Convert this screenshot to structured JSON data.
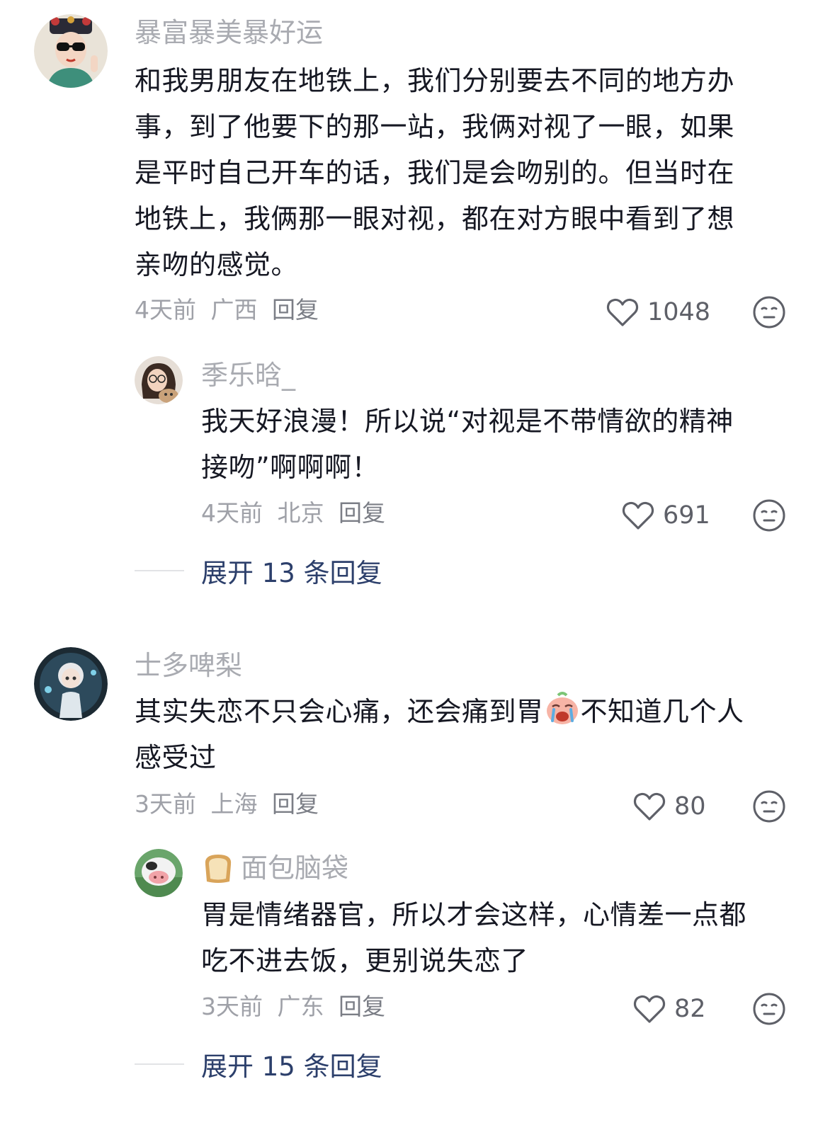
{
  "comments": [
    {
      "username": "暴富暴美暴好运",
      "text_lines": [
        "和我男朋友在地铁上，我们分别要去不同的地方办",
        "事，到了他要下的那一站，我俩对视了一眼，如果",
        "是平时自己开车的话，我们是会吻别的。但当时在",
        "地铁上，我俩那一眼对视，都在对方眼中看到了想",
        "亲吻的感觉。"
      ],
      "time": "4天前",
      "location": "广西",
      "reply_label": "回复",
      "likes": "1048",
      "reply": {
        "username": "季乐晗_",
        "text_lines": [
          "我天好浪漫！所以说“对视是不带情欲的精神",
          "接吻”啊啊啊！"
        ],
        "time": "4天前",
        "location": "北京",
        "reply_label": "回复",
        "likes": "691"
      },
      "expand_label": "展开 13 条回复"
    },
    {
      "username": "士多啤梨",
      "text_line1_before": "其实失恋不只会心痛，还会痛到胃",
      "text_line1_after": "不知道几个人",
      "text_line2": "感受过",
      "time": "3天前",
      "location": "上海",
      "reply_label": "回复",
      "likes": "80",
      "reply": {
        "username": "面包脑袋",
        "text_lines": [
          "胃是情绪器官，所以才会这样，心情差一点都",
          "吃不进去饭，更别说失恋了"
        ],
        "time": "3天前",
        "location": "广东",
        "reply_label": "回复",
        "likes": "82"
      },
      "expand_label": "展开 15 条回复"
    }
  ],
  "icons": {
    "like": "heart-outline-icon",
    "emoji": "neutral-face-icon",
    "inline_emoji": "crying-face-emoji",
    "username_emoji": "bread-emoji"
  },
  "colors": {
    "text": "#161823",
    "username": "#a9abb1",
    "meta": "#9fa1a8",
    "expand": "#2c3f6b"
  }
}
